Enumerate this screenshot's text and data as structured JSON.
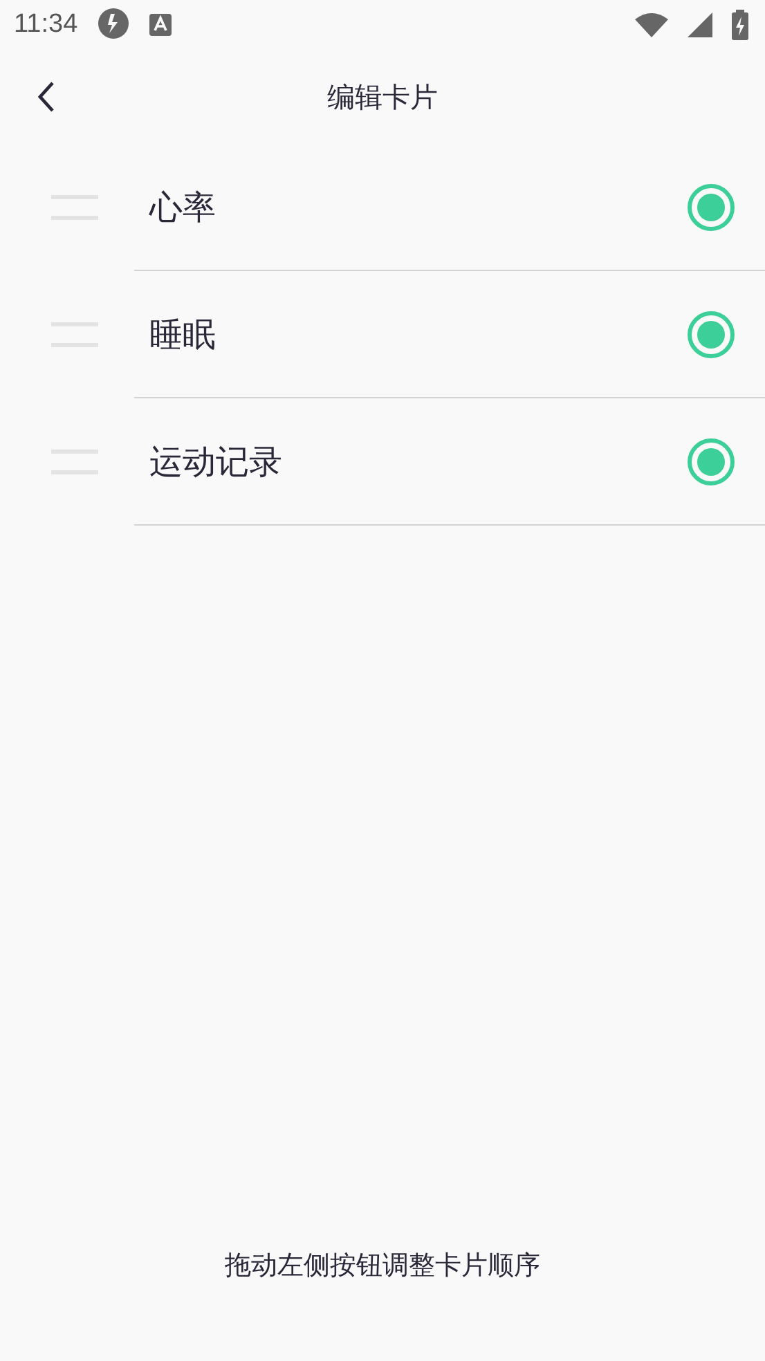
{
  "status_bar": {
    "time": "11:34"
  },
  "header": {
    "title": "编辑卡片"
  },
  "cards": [
    {
      "label": "心率",
      "selected": true
    },
    {
      "label": "睡眠",
      "selected": true
    },
    {
      "label": "运动记录",
      "selected": true
    }
  ],
  "footer": {
    "hint": "拖动左侧按钮调整卡片顺序"
  }
}
